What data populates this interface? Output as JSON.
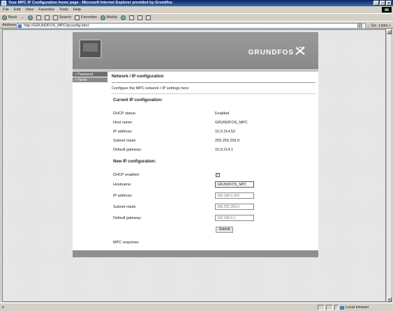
{
  "window": {
    "title": "Your MPC IP Configuration home page - Microsoft Internet Explorer provided by Grundfos",
    "buttons": [
      "_",
      "ง",
      "X"
    ]
  },
  "menu": [
    "File",
    "Edit",
    "View",
    "Favorites",
    "Tools",
    "Help"
  ],
  "toolbar": {
    "back": "Back",
    "forward": "→",
    "search": "Search",
    "favorites": "Favorites",
    "media": "Media"
  },
  "address": {
    "label": "Address",
    "url": "http://GRUNDFOS_MPC/ipconfig.html",
    "go": "Go",
    "links": "Links"
  },
  "banner": {
    "brand": "GRUNDFOS"
  },
  "sidebar": {
    "items": [
      {
        "label": "> Password"
      },
      {
        "label": "> Home"
      }
    ]
  },
  "page": {
    "title": "Network / IP configuration",
    "description": "Configure the MPC network / IP settings here",
    "current_heading": "Current IP configuration:",
    "current": [
      {
        "label": "DHCP status:",
        "value": "Enabled"
      },
      {
        "label": "Host name:",
        "value": "GRUNDFOS_MPC"
      },
      {
        "label": "IP address:",
        "value": "10.0.214.52"
      },
      {
        "label": "Subnet mask:",
        "value": "255.255.255.0"
      },
      {
        "label": "Default gateway:",
        "value": "10.0.214.1"
      }
    ],
    "new_heading": "New IP configuration:",
    "dhcp_label": "DHCP enabled:",
    "dhcp_checked": "✓",
    "hostname_label": "Hostname:",
    "hostname_value": "GRUNDFOS_MPC",
    "ip_label": "IP address:",
    "ip_placeholder": "192.168.0.102",
    "subnet_label": "Subnet mask:",
    "subnet_placeholder": "255.255.255.0",
    "gateway_label": "Default gateway:",
    "gateway_placeholder": "192.168.0.1",
    "submit": "Submit",
    "response_label": "MPC response:"
  },
  "status": {
    "left": "Done",
    "zone": "Local intranet"
  },
  "colors": {
    "titlebar": "#0a246a",
    "banner": "#8f8f8f",
    "sidebar_item": "#6e6e6e"
  }
}
